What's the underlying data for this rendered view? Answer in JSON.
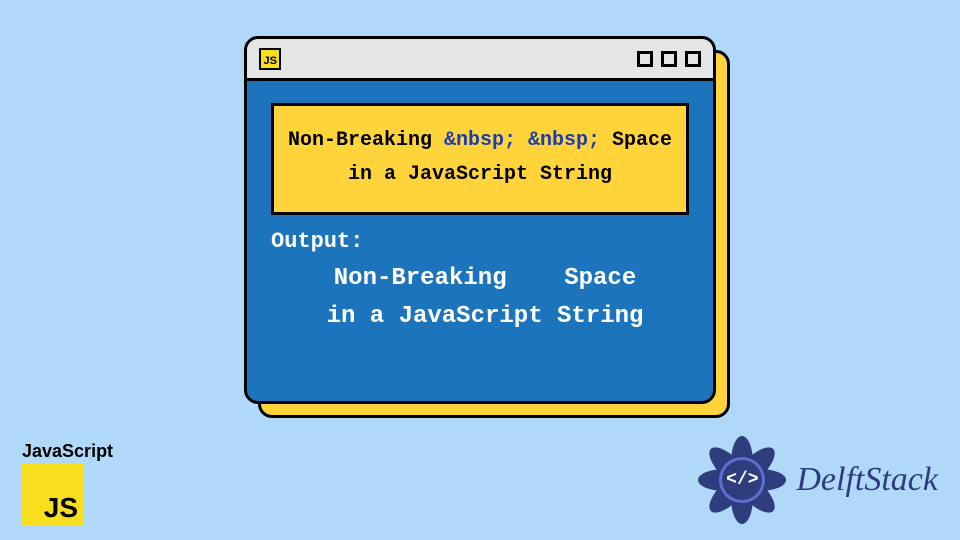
{
  "titlebar": {
    "badge_text": "JS"
  },
  "card": {
    "line1_a": "Non-Breaking ",
    "nbsp1": "&nbsp;",
    "line1_sep": " ",
    "nbsp2": "&nbsp;",
    "line1_b": " Space",
    "line2": "in a JavaScript String"
  },
  "output": {
    "label": "Output:",
    "line1": "Non-Breaking    Space",
    "line2": "in a JavaScript String"
  },
  "js_corner": {
    "label": "JavaScript",
    "badge": "JS"
  },
  "delft": {
    "brand": "DelftStack",
    "center": "</>"
  }
}
